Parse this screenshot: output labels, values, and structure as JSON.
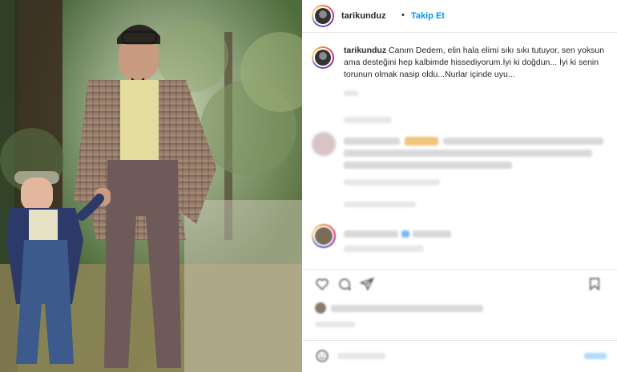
{
  "post": {
    "username": "tarikunduz",
    "separator": "•",
    "follow_label": "Takip Et",
    "caption_username": "tarikunduz",
    "caption_text": "Canım Dedem, elin hala elimi sıkı sıkı tutuyor, sen yoksun ama desteğini hep kalbimde hissediyorum.İyi ki doğdun... İyi ki senin torunun olmak nasip oldu...Nurlar içinde uyu..."
  },
  "icons": [
    "heart-icon",
    "comment-icon",
    "share-icon",
    "bookmark-icon",
    "emoji-icon"
  ],
  "colors": {
    "link": "#0095f6",
    "text": "#262626",
    "divider": "#e6e6e6"
  }
}
